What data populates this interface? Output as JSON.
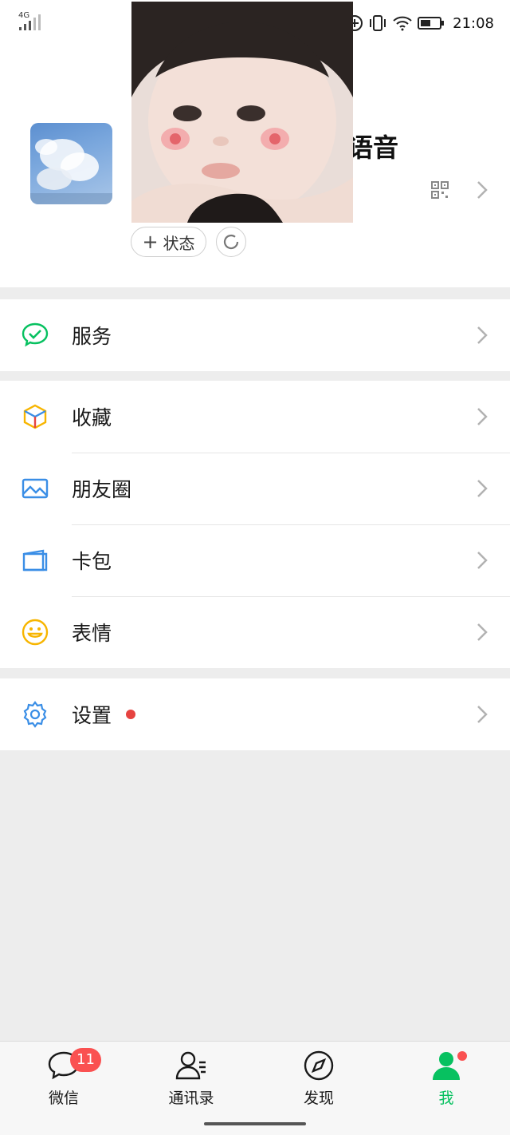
{
  "status_bar": {
    "network": "4G",
    "time": "21:08"
  },
  "profile": {
    "nickname": "语音",
    "status_button_label": "状态",
    "icons": [
      "qr-code-icon",
      "chevron-right-icon",
      "plus-icon",
      "refresh-icon"
    ]
  },
  "menu": {
    "services": {
      "label": "服务",
      "icon": "wechat-pay-icon"
    },
    "favorites": {
      "label": "收藏",
      "icon": "cube-icon"
    },
    "moments": {
      "label": "朋友圈",
      "icon": "image-icon"
    },
    "cards": {
      "label": "卡包",
      "icon": "wallet-icon"
    },
    "stickers": {
      "label": "表情",
      "icon": "smiley-icon"
    },
    "settings": {
      "label": "设置",
      "icon": "gear-icon",
      "has_red_dot": true
    }
  },
  "tabbar": {
    "chats": {
      "label": "微信",
      "badge": "11"
    },
    "contacts": {
      "label": "通讯录"
    },
    "discover": {
      "label": "发现"
    },
    "me": {
      "label": "我",
      "active": true,
      "has_red_dot": true
    }
  },
  "colors": {
    "accent": "#07c160",
    "badge": "#fa5151",
    "background": "#ededed"
  }
}
